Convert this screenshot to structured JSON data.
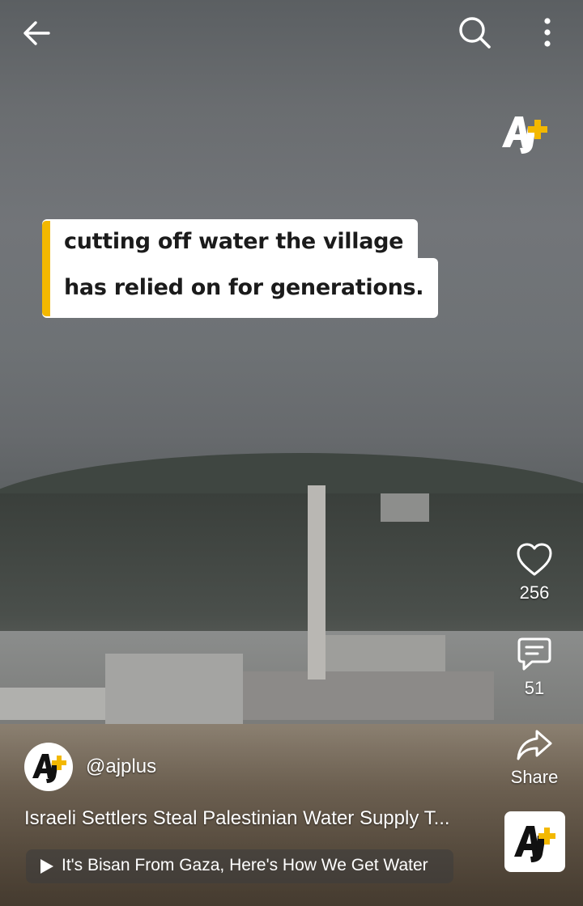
{
  "video": {
    "caption_line1": "cutting off water the village",
    "caption_line2": "has relied on for generations."
  },
  "top_bar": {
    "back_icon": "arrow-left-icon",
    "search_icon": "search-icon",
    "more_icon": "more-vertical-icon"
  },
  "actions": {
    "likes": "256",
    "comments": "51",
    "share_label": "Share"
  },
  "channel": {
    "handle": "@ajplus",
    "brand_color": "#f3b800"
  },
  "title": "Israeli Settlers Steal Palestinian Water Supply T...",
  "related": {
    "label": "It's Bisan From Gaza, Here's How We Get Water"
  }
}
